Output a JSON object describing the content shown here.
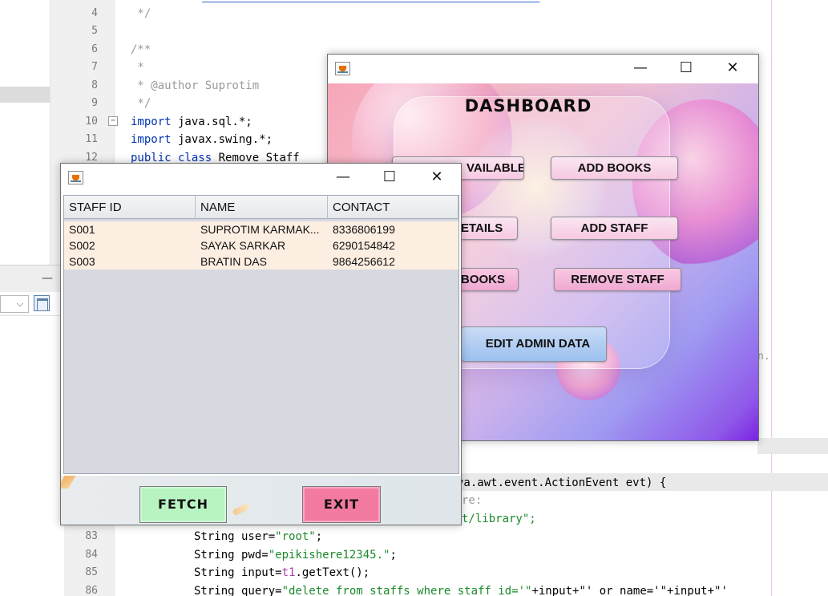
{
  "ide": {
    "lines": [
      {
        "no": "4",
        "text": " */",
        "cls": "c-com"
      },
      {
        "no": "5",
        "text": "",
        "cls": ""
      },
      {
        "no": "6",
        "text": "/**",
        "cls": "c-com"
      },
      {
        "no": "7",
        "text": " *",
        "cls": "c-com"
      },
      {
        "no": "8",
        "text": " * @author Suprotim",
        "cls": "c-com"
      },
      {
        "no": "9",
        "text": " */",
        "cls": "c-com"
      },
      {
        "no": "10",
        "text_kw": "import",
        "text_rest": " java.sql.*;"
      },
      {
        "no": "11",
        "text_kw": "import",
        "text_rest": " javax.swing.*;"
      },
      {
        "no": "12",
        "text_kw": "public class",
        "text_rest": " Remove Staff"
      }
    ],
    "lower": {
      "action_line": "va.awt.event.ActionEvent evt) {",
      "comment_frag": "re:",
      "url_frag": "t/library\";",
      "line83": {
        "no": "83",
        "pre": "String user=",
        "str": "\"root\"",
        "post": ";"
      },
      "line84": {
        "no": "84",
        "pre": "String pwd=",
        "str": "\"epikishere12345.\"",
        "post": ";"
      },
      "line85": {
        "no": "85",
        "pre": "String input=",
        "var": "t1",
        "post": ".getText();"
      },
      "line86": {
        "no": "86",
        "pre": "String query=",
        "str": "\"delete from staffs where staff_id='\"",
        "post": "+input+\"' or name='\"+input+\"'"
      },
      "right_frag": "n."
    }
  },
  "dashboard": {
    "title": "DASHBOARD",
    "buttons": {
      "available": "VAILABLE",
      "add_books": "ADD BOOKS",
      "details": "ETAILS",
      "add_staff": "ADD STAFF",
      "books": "BOOKS",
      "remove_staff": "REMOVE STAFF",
      "edit_admin": "EDIT ADMIN DATA"
    }
  },
  "staff_window": {
    "columns": [
      "STAFF ID",
      "NAME",
      "CONTACT"
    ],
    "rows": [
      {
        "id": "S001",
        "name": "SUPROTIM KARMAK...",
        "contact": "8336806199"
      },
      {
        "id": "S002",
        "name": "SAYAK SARKAR",
        "contact": "6290154842"
      },
      {
        "id": "S003",
        "name": "BRATIN DAS",
        "contact": "9864256612"
      }
    ],
    "fetch_label": "FETCH",
    "exit_label": "EXIT"
  },
  "window_controls": {
    "minimize": "—",
    "maximize": "☐",
    "close": "✕"
  },
  "colors": {
    "keyword": "#0033b3",
    "string": "#1a8a2a",
    "comment": "#9a9a9a",
    "fetch_button": "#b7f4c2",
    "exit_button": "#f37aa0",
    "row_bg": "#fdeee2"
  }
}
